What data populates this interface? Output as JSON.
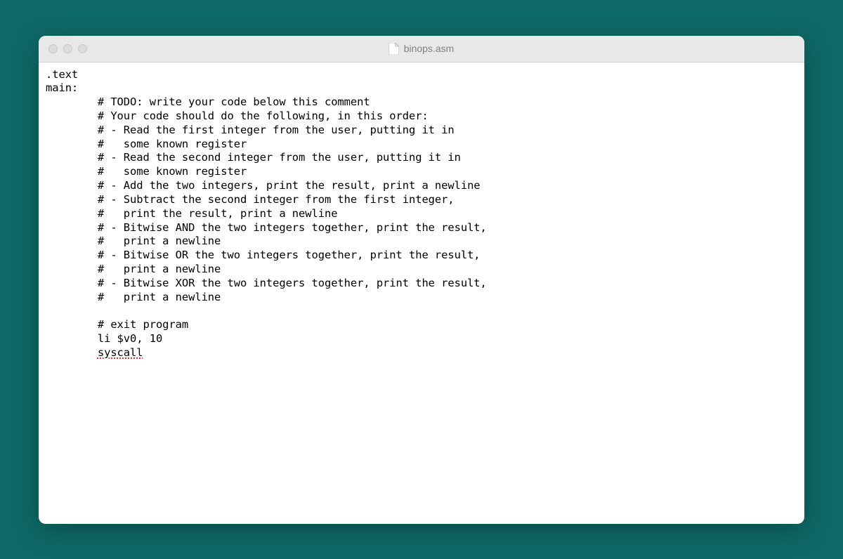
{
  "window": {
    "title": "binops.asm"
  },
  "code": {
    "line1": ".text",
    "line2": "main:",
    "line3": "        # TODO: write your code below this comment",
    "line4": "        # Your code should do the following, in this order:",
    "line5": "        # - Read the first integer from the user, putting it in",
    "line6": "        #   some known register",
    "line7": "        # - Read the second integer from the user, putting it in",
    "line8": "        #   some known register",
    "line9": "        # - Add the two integers, print the result, print a newline",
    "line10": "        # - Subtract the second integer from the first integer,",
    "line11": "        #   print the result, print a newline",
    "line12": "        # - Bitwise AND the two integers together, print the result,",
    "line13": "        #   print a newline",
    "line14": "        # - Bitwise OR the two integers together, print the result,",
    "line15": "        #   print a newline",
    "line16": "        # - Bitwise XOR the two integers together, print the result,",
    "line17": "        #   print a newline",
    "line18": "",
    "line19": "        # exit program",
    "line20": "        li $v0, 10",
    "line21_prefix": "        ",
    "line21_word": "syscall"
  }
}
